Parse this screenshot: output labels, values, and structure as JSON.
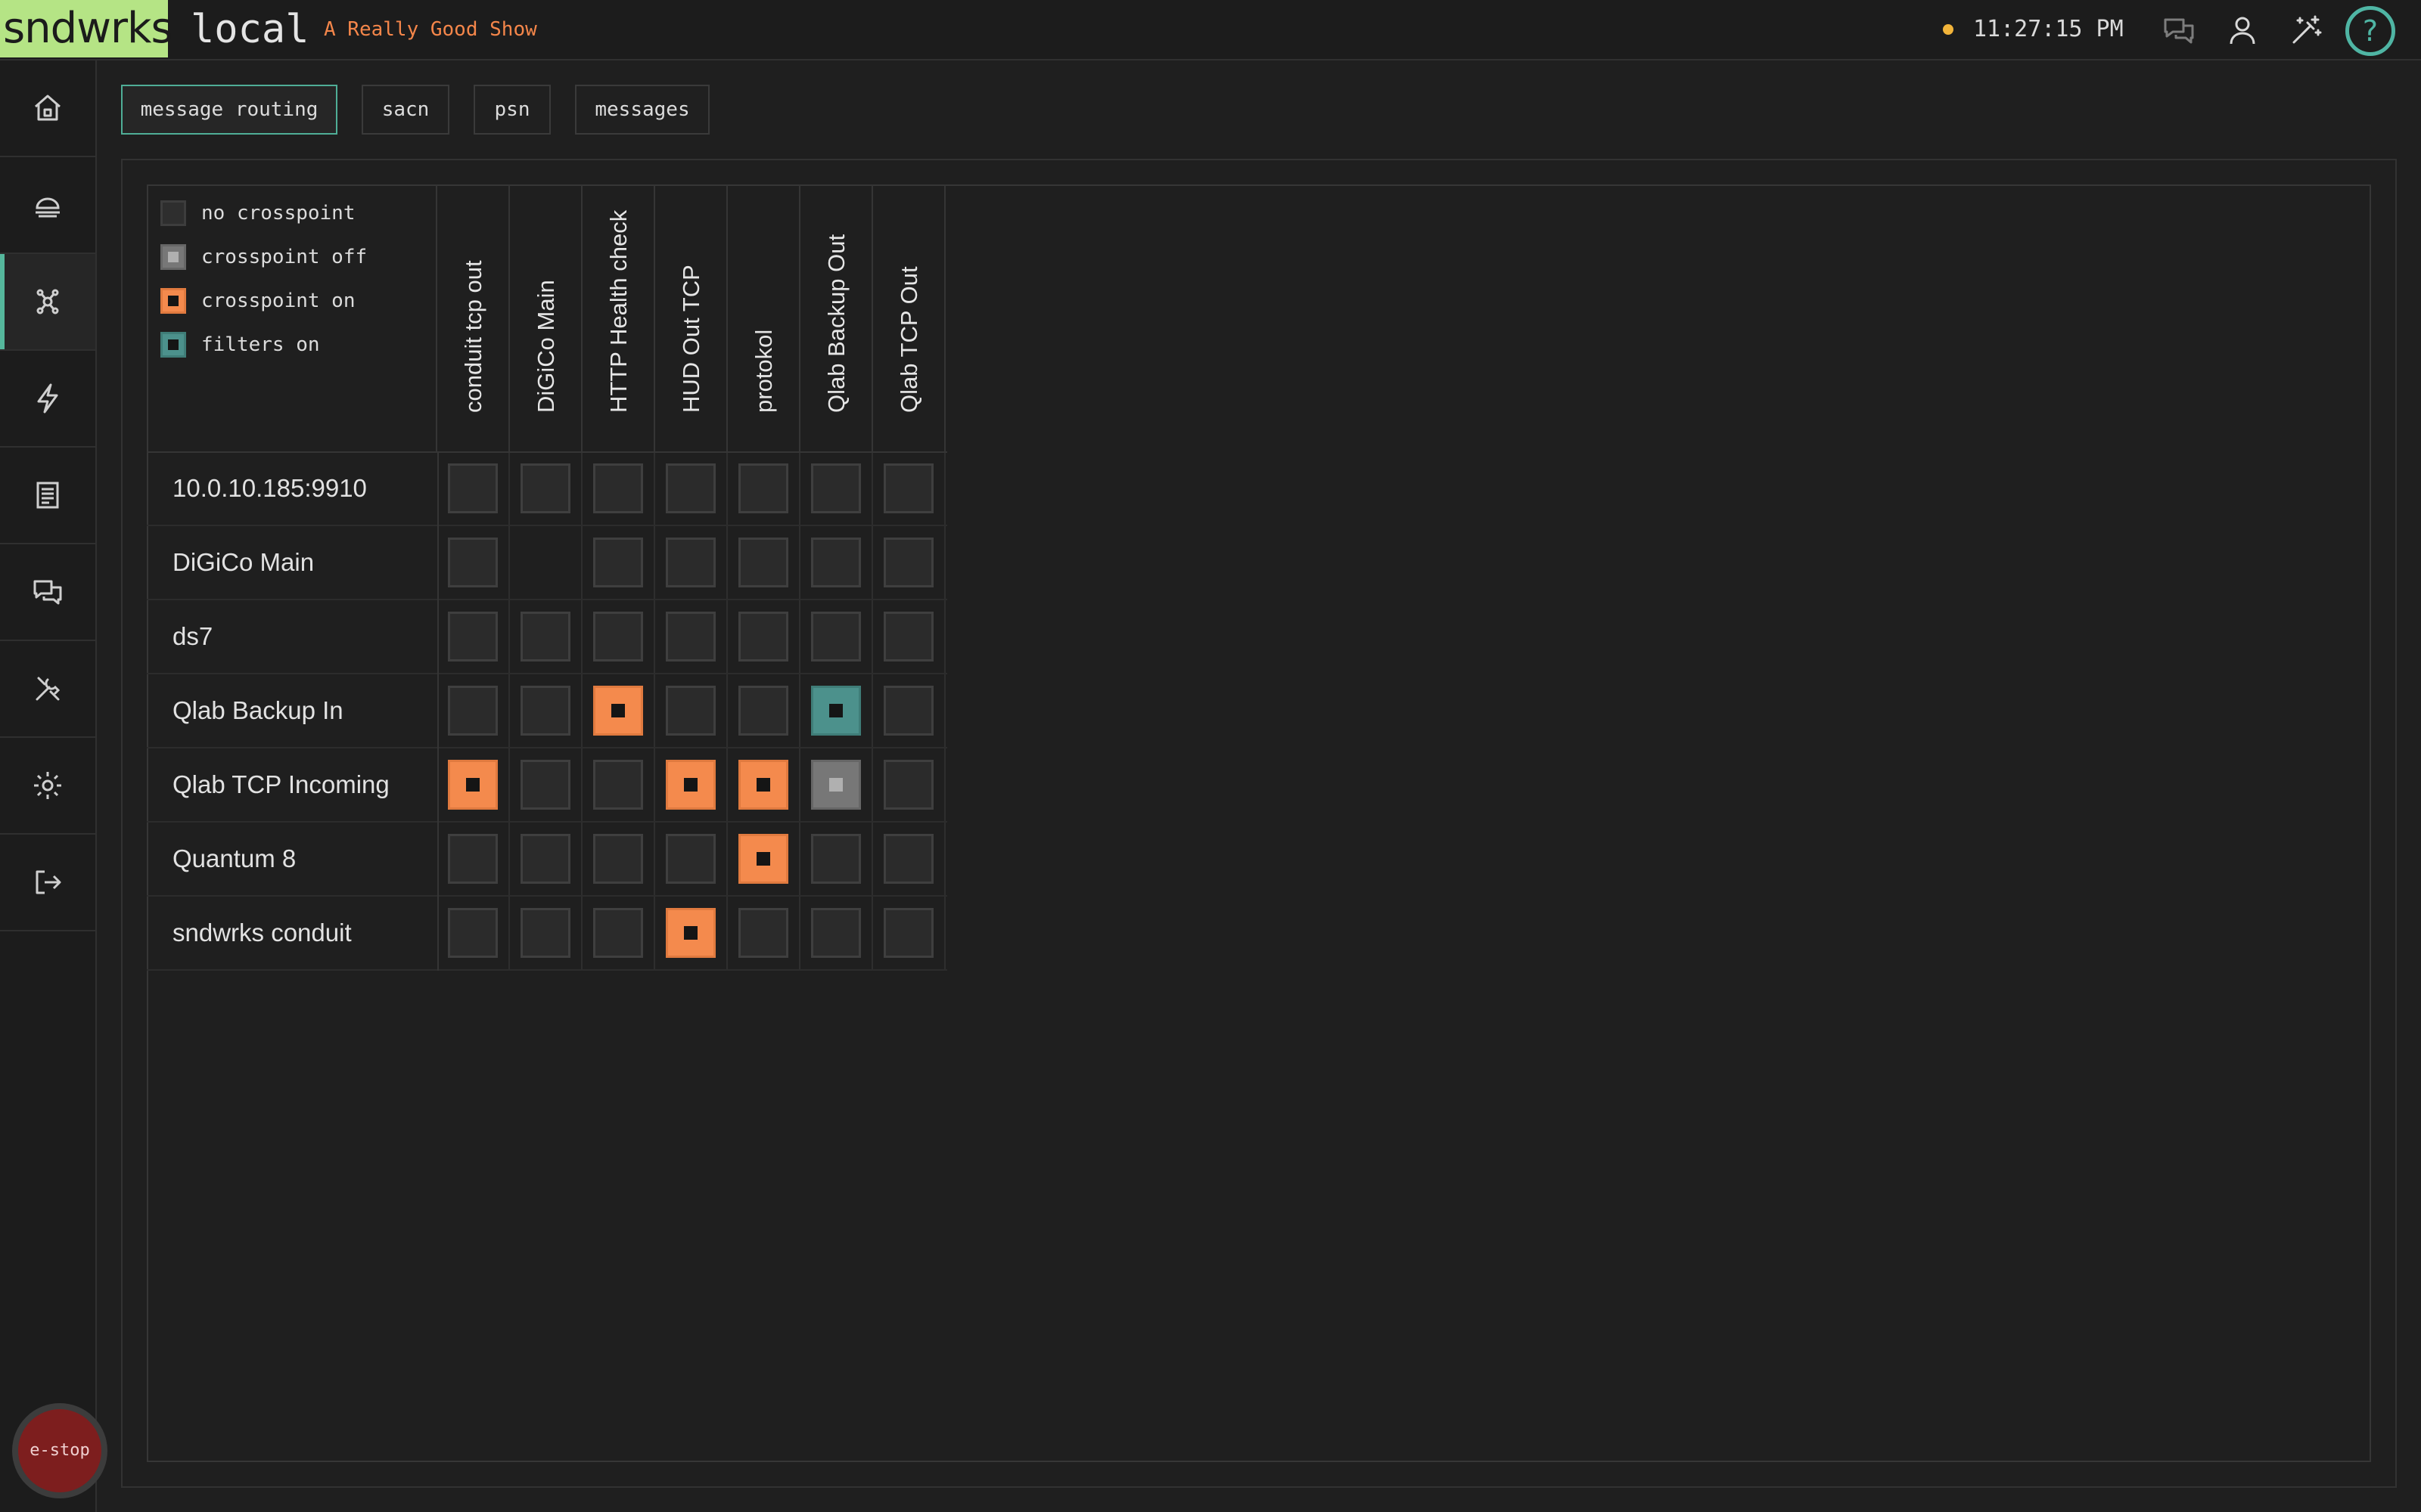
{
  "app": {
    "logo": "sndwrks",
    "instance": "local",
    "show_name": "A Really Good Show",
    "clock": "11:27:15 PM",
    "help_label": "?",
    "estop_label": "e-stop",
    "accent_color": "#55b79c",
    "status_dot_color": "#f2b43a"
  },
  "top_icons": [
    "chat-icon",
    "user-icon",
    "magic-wand-icon",
    "help-icon"
  ],
  "sidebar": {
    "items": [
      {
        "icon": "home-icon",
        "active": false
      },
      {
        "icon": "lighting-icon",
        "active": false
      },
      {
        "icon": "routing-icon",
        "active": true
      },
      {
        "icon": "lightning-icon",
        "active": false
      },
      {
        "icon": "document-icon",
        "active": false
      },
      {
        "icon": "messages-icon",
        "active": false
      },
      {
        "icon": "tools-icon",
        "active": false
      },
      {
        "icon": "settings-icon",
        "active": false
      },
      {
        "icon": "logout-icon",
        "active": false
      }
    ]
  },
  "tabs": [
    {
      "label": "message routing",
      "active": true
    },
    {
      "label": "sacn",
      "active": false
    },
    {
      "label": "psn",
      "active": false
    },
    {
      "label": "messages",
      "active": false
    }
  ],
  "legend": [
    {
      "label": "no crosspoint",
      "state": "none"
    },
    {
      "label": "crosspoint off",
      "state": "off"
    },
    {
      "label": "crosspoint on",
      "state": "on"
    },
    {
      "label": "filters on",
      "state": "filter"
    }
  ],
  "matrix": {
    "columns": [
      "conduit tcp out",
      "DiGiCo Main",
      "HTTP Health check",
      "HUD Out TCP",
      "protokol",
      "Qlab Backup Out",
      "Qlab TCP Out"
    ],
    "rows": [
      {
        "label": "10.0.10.185:9910",
        "cells": [
          "none",
          "none",
          "none",
          "none",
          "none",
          "none",
          "none"
        ]
      },
      {
        "label": "DiGiCo Main",
        "cells": [
          "none",
          "blank",
          "none",
          "none",
          "none",
          "none",
          "none"
        ]
      },
      {
        "label": "ds7",
        "cells": [
          "none",
          "none",
          "none",
          "none",
          "none",
          "none",
          "none"
        ]
      },
      {
        "label": "Qlab Backup In",
        "cells": [
          "none",
          "none",
          "on",
          "none",
          "none",
          "filter",
          "none"
        ]
      },
      {
        "label": "Qlab TCP Incoming",
        "cells": [
          "on",
          "none",
          "none",
          "on",
          "on",
          "off",
          "none"
        ]
      },
      {
        "label": "Quantum 8",
        "cells": [
          "none",
          "none",
          "none",
          "none",
          "on",
          "none",
          "none"
        ]
      },
      {
        "label": "sndwrks conduit",
        "cells": [
          "none",
          "none",
          "none",
          "on",
          "none",
          "none",
          "none"
        ]
      }
    ]
  }
}
